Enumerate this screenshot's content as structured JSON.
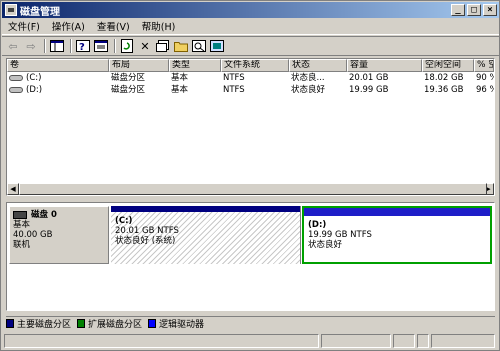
{
  "window": {
    "title": "磁盘管理"
  },
  "menu": [
    "文件(F)",
    "操作(A)",
    "查看(V)",
    "帮助(H)"
  ],
  "toolbar_icons": [
    "back-arrow-icon",
    "forward-arrow-icon",
    "console-tree-icon",
    "properties-icon",
    "help-icon",
    "console-icon",
    "refresh-icon",
    "delete-icon",
    "properties-sheet-icon",
    "open-folder-icon",
    "search-icon",
    "export-icon"
  ],
  "volume_table": {
    "columns": [
      "卷",
      "布局",
      "类型",
      "文件系统",
      "状态",
      "容量",
      "空闲空间",
      "% 空"
    ],
    "rows": [
      [
        "(C:)",
        "磁盘分区",
        "基本",
        "NTFS",
        "状态良...",
        "20.01 GB",
        "18.02 GB",
        "90 %"
      ],
      [
        "(D:)",
        "磁盘分区",
        "基本",
        "NTFS",
        "状态良好",
        "19.99 GB",
        "19.36 GB",
        "96 %"
      ]
    ]
  },
  "disk": {
    "name": "磁盘 0",
    "type": "基本",
    "size": "40.00 GB",
    "status": "联机",
    "partitions": [
      {
        "label": "(C:)",
        "size_fs": "20.01 GB NTFS",
        "status": "状态良好 (系统)",
        "bar_color": "#000080"
      },
      {
        "label": "(D:)",
        "size_fs": "19.99 GB NTFS",
        "status": "状态良好",
        "bar_color": "#1e1ec8"
      }
    ]
  },
  "legend": [
    {
      "label": "主要磁盘分区",
      "color": "#000080"
    },
    {
      "label": "扩展磁盘分区",
      "color": "#008000"
    },
    {
      "label": "逻辑驱动器",
      "color": "#0000ff"
    }
  ]
}
